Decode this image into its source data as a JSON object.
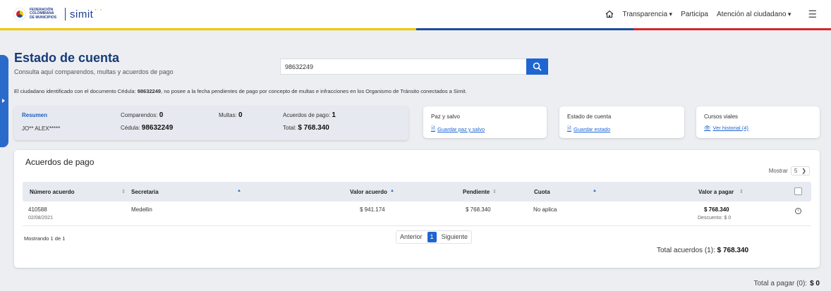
{
  "header": {
    "logo_fed_line1": "FEDERACIÓN",
    "logo_fed_line2": "COLOMBIANA",
    "logo_fed_line3": "DE MUNICIPIOS",
    "logo_brand": "simit",
    "nav": [
      {
        "label": "Transparencia"
      },
      {
        "label": "Participa"
      },
      {
        "label": "Atención al ciudadano"
      }
    ],
    "icons": {
      "home": "home-icon",
      "menu": "hamburger-menu-icon"
    }
  },
  "stripe_colors": [
    "#f2c500",
    "#1e4b9b",
    "#d8232a"
  ],
  "page": {
    "title": "Estado de cuenta",
    "subtitle": "Consulta aquí comparendos, multas y acuerdos de pago"
  },
  "search": {
    "value": "98632249",
    "icon": "search-icon",
    "button_color": "#1e65d1"
  },
  "notice": {
    "prefix": "El ciudadano identificado con el documento Cédula: ",
    "document": "98632249",
    "suffix": ", no posee a la fecha pendientes de pago por concepto de multas e infracciones en los Organismo de Tránsito conectados a Simit."
  },
  "summary": {
    "label": "Resumen",
    "name": "JO** ALEX*****",
    "comparendos_label": "Comparendos: ",
    "comparendos_value": "0",
    "cedula_label": "Cédula: ",
    "cedula_value": "98632249",
    "multas_label": "Multas: ",
    "multas_value": "0",
    "acuerdos_label": "Acuerdos de pago: ",
    "acuerdos_value": "1",
    "total_label": "Total: ",
    "total_value": "$ 768.340"
  },
  "cards": [
    {
      "title": "Paz y salvo",
      "link": "Guardar paz y salvo"
    },
    {
      "title": "Estado de cuenta",
      "link": "Guardar estado"
    },
    {
      "title": "Cursos viales",
      "link": "Ver historial (4)"
    }
  ],
  "acuerdos": {
    "title": "Acuerdos de pago",
    "mostrar_label": "Mostrar",
    "mostrar_value": "5",
    "columns": [
      "Número acuerdo",
      "Secretaria",
      "Valor acuerdo",
      "Pendiente",
      "Cuota",
      "Valor a pagar"
    ],
    "rows": [
      {
        "numero": "410588",
        "fecha": "02/08/2021",
        "secretaria": "Medellin",
        "valor_acuerdo": "$ 941.174",
        "pendiente": "$ 768.340",
        "cuota": "No aplica",
        "valor_pagar": "$ 768.340",
        "descuento": "Descuento: $ 0"
      }
    ],
    "showing": "Mostrando 1 de 1",
    "pager": {
      "prev": "Anterior",
      "current": "1",
      "next": "Siguiente"
    },
    "total_label": "Total acuerdos (1): ",
    "total_value": "$ 768.340"
  },
  "grand_total": {
    "label": "Total a pagar (0):",
    "value": "$ 0"
  }
}
